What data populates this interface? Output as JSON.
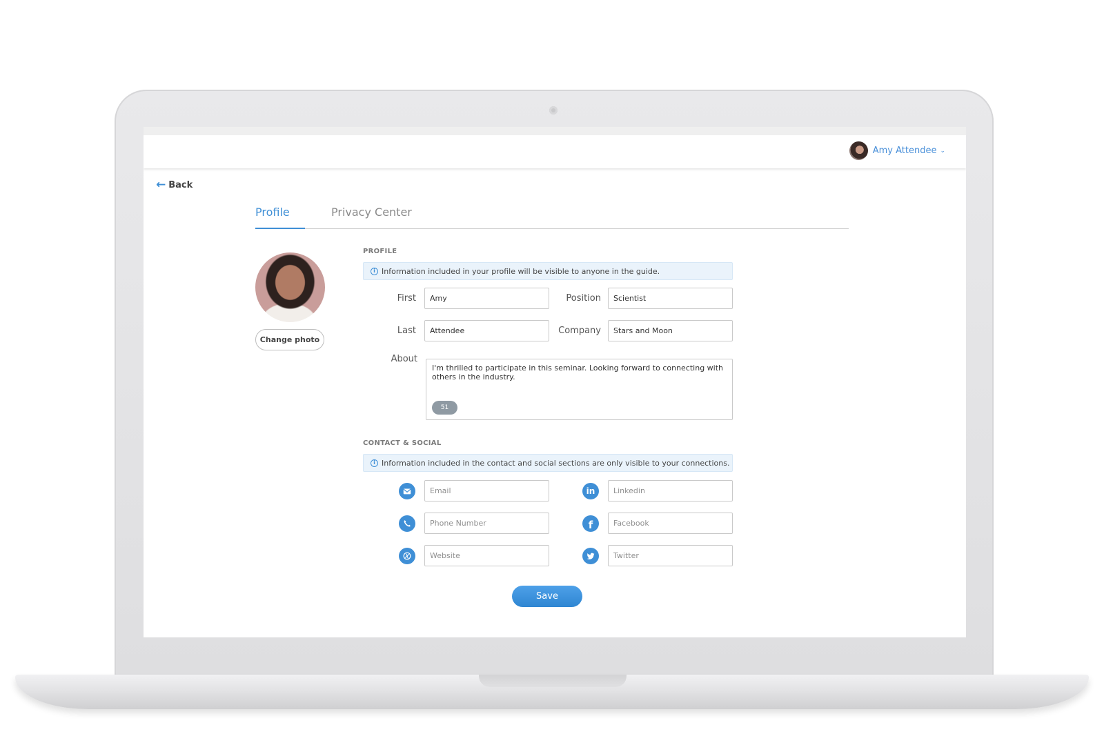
{
  "header": {
    "user_name": "Amy Attendee",
    "chevron": "⌄"
  },
  "nav": {
    "back_label": "Back",
    "back_icon": "←"
  },
  "tabs": [
    {
      "label": "Profile",
      "active": true
    },
    {
      "label": "Privacy Center",
      "active": false
    }
  ],
  "photo": {
    "change_label": "Change photo"
  },
  "profile_section": {
    "title": "PROFILE",
    "notice": "Information included in your profile will be visible to anyone in the guide.",
    "fields": {
      "first_label": "First",
      "first_value": "Amy",
      "last_label": "Last",
      "last_value": "Attendee",
      "position_label": "Position",
      "position_value": "Scientist",
      "company_label": "Company",
      "company_value": "Stars and Moon",
      "about_label": "About",
      "about_value": "I'm thrilled to participate in this seminar. Looking forward to connecting with others in the industry.",
      "about_count": "51"
    }
  },
  "contact_section": {
    "title": "CONTACT & SOCIAL",
    "notice": "Information included in the contact and social sections are only visible to your connections.",
    "email_placeholder": "Email",
    "phone_placeholder": "Phone Number",
    "website_placeholder": "Website",
    "linkedin_placeholder": "Linkedin",
    "facebook_placeholder": "Facebook",
    "twitter_placeholder": "Twitter",
    "linkedin_glyph": "in",
    "facebook_glyph": "f"
  },
  "actions": {
    "save_label": "Save"
  },
  "colors": {
    "accent": "#3f8fd6",
    "notice_bg": "#eaf3fb",
    "count_badge": "#8f9aa3"
  },
  "icons": [
    "chevron-down-icon",
    "back-arrow-icon",
    "info-icon",
    "email-icon",
    "phone-icon",
    "website-icon",
    "linkedin-icon",
    "facebook-icon",
    "twitter-icon"
  ]
}
